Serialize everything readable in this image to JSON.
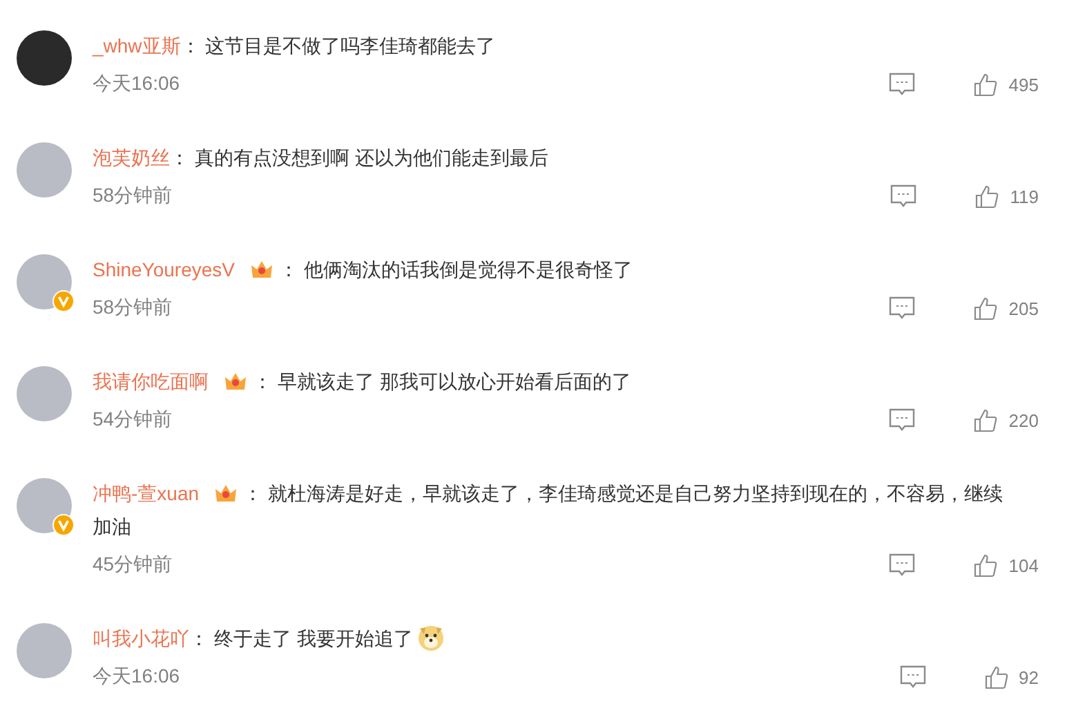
{
  "comments": [
    {
      "user": "_whw亚斯",
      "crown_badge": false,
      "verified": false,
      "text": "： 这节目是不做了吗李佳琦都能去了",
      "emoji": false,
      "time": "今天16:06",
      "likes": "495"
    },
    {
      "user": "泡芙奶丝",
      "crown_badge": false,
      "verified": false,
      "text": "： 真的有点没想到啊 还以为他们能走到最后",
      "emoji": false,
      "time": "58分钟前",
      "likes": "119"
    },
    {
      "user": "ShineYoureyesV",
      "crown_badge": true,
      "verified": true,
      "text": "： 他俩淘汰的话我倒是觉得不是很奇怪了",
      "emoji": false,
      "time": "58分钟前",
      "likes": "205"
    },
    {
      "user": "我请你吃面啊",
      "crown_badge": true,
      "verified": false,
      "text": "： 早就该走了 那我可以放心开始看后面的了",
      "emoji": false,
      "time": "54分钟前",
      "likes": "220"
    },
    {
      "user": "冲鸭-萱xuan",
      "crown_badge": true,
      "verified": true,
      "text": "： 就杜海涛是好走，早就该走了，李佳琦感觉还是自己努力坚持到现在的，不容易，继续加油",
      "emoji": false,
      "time": "45分钟前",
      "likes": "104"
    },
    {
      "user": "叫我小花吖",
      "crown_badge": false,
      "verified": false,
      "text": "： 终于走了 我要开始追了",
      "emoji": true,
      "time": "今天16:06",
      "likes": "92"
    }
  ]
}
